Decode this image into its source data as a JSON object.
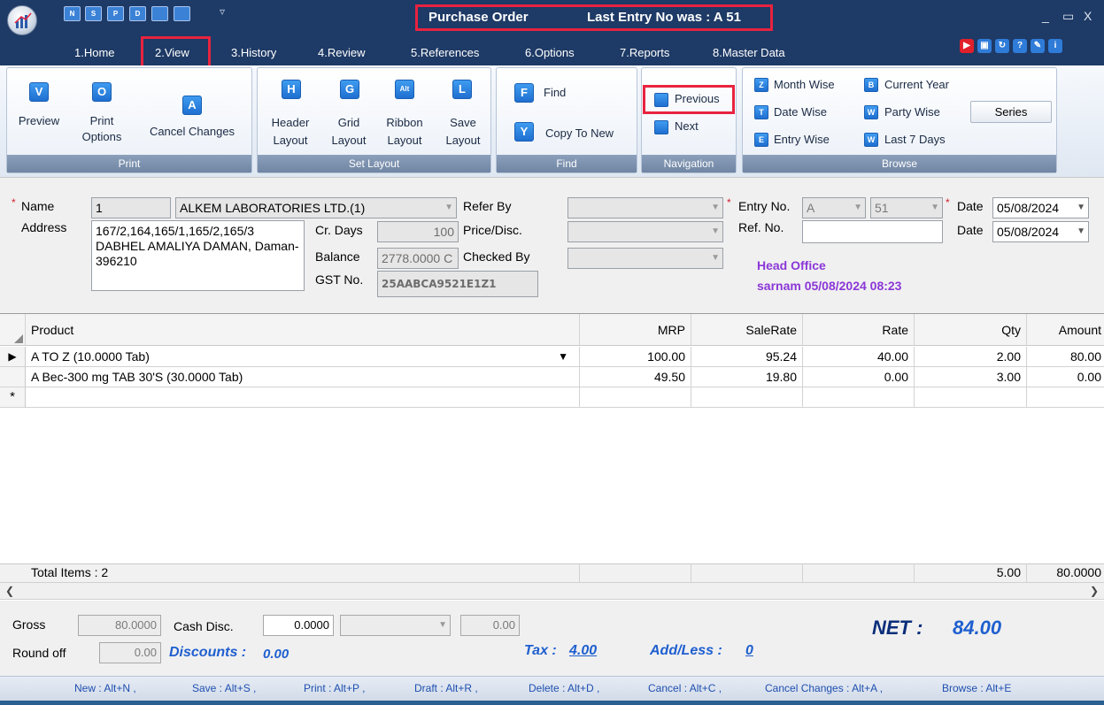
{
  "title": {
    "main": "Purchase Order",
    "last_entry": "Last Entry No was : A 51"
  },
  "quick_access": [
    "N",
    "S",
    "P",
    "D",
    "",
    ""
  ],
  "quick_access_more": "▿",
  "window_controls": [
    "_",
    "▭",
    "X"
  ],
  "menu": [
    "1.Home",
    "2.View",
    "3.History",
    "4.Review",
    "5.References",
    "6.Options",
    "7.Reports",
    "8.Master Data"
  ],
  "ribbon": {
    "print": {
      "caption": "Print",
      "preview": {
        "icon": "V",
        "label": "Preview"
      },
      "print_options": {
        "icon": "O",
        "label1": "Print",
        "label2": "Options"
      },
      "cancel_changes": {
        "icon": "A",
        "label": "Cancel Changes"
      }
    },
    "set_layout": {
      "caption": "Set Layout",
      "header": {
        "icon": "H",
        "label1": "Header",
        "label2": "Layout"
      },
      "grid": {
        "icon": "G",
        "label1": "Grid",
        "label2": "Layout"
      },
      "ribbon": {
        "icon": "Alt",
        "label1": "Ribbon",
        "label2": "Layout"
      },
      "save": {
        "icon": "L",
        "label1": "Save",
        "label2": "Layout"
      }
    },
    "find": {
      "caption": "Find",
      "find": {
        "icon": "F",
        "label": "Find"
      },
      "copy": {
        "icon": "Y",
        "label": "Copy To New"
      }
    },
    "navigation": {
      "caption": "Navigation",
      "previous": {
        "icon": "",
        "label": "Previous"
      },
      "next": {
        "icon": "",
        "label": "Next"
      }
    },
    "browse": {
      "caption": "Browse",
      "month_wise": {
        "icon": "Z",
        "label": "Month Wise"
      },
      "date_wise": {
        "icon": "T",
        "label": "Date Wise"
      },
      "entry_wise": {
        "icon": "E",
        "label": "Entry Wise"
      },
      "current_year": {
        "icon": "B",
        "label": "Current Year"
      },
      "party_wise": {
        "icon": "W",
        "label": "Party Wise"
      },
      "last_7_days": {
        "icon": "W",
        "label": "Last 7 Days"
      },
      "series": "Series"
    }
  },
  "form": {
    "required_mark": "*",
    "name_label": "Name",
    "name_code": "1",
    "name_value": "ALKEM LABORATORIES LTD.(1)",
    "address_label": "Address",
    "address_value": "167/2,164,165/1,165/2,165/3 DABHEL AMALIYA DAMAN, Daman- 396210",
    "cr_days_label": "Cr. Days",
    "cr_days_value": "100",
    "balance_label": "Balance",
    "balance_value": "2778.0000 C",
    "gst_label": "GST No.",
    "gst_value": "25AABCA9521E1Z1",
    "refer_by_label": "Refer By",
    "price_disc_label": "Price/Disc.",
    "checked_by_label": "Checked By",
    "entry_no_label": "Entry No.",
    "entry_series": "A",
    "entry_number": "51",
    "ref_no_label": "Ref. No.",
    "ref_no_value": "",
    "date_label": "Date",
    "date_value": "05/08/2024",
    "date2_label": "Date",
    "date2_value": "05/08/2024",
    "branch": "Head Office",
    "user_line": "sarnam 05/08/2024 08:23"
  },
  "grid": {
    "columns": [
      "Product",
      "MRP",
      "SaleRate",
      "Rate",
      "Qty",
      "Amount"
    ],
    "rows": [
      {
        "product": "A TO Z (10.0000  Tab)",
        "mrp": "100.00",
        "sale_rate": "95.24",
        "rate": "40.00",
        "qty": "2.00",
        "amount": "80.00"
      },
      {
        "product": "A Bec-300 mg TAB 30'S (30.0000  Tab)",
        "mrp": "49.50",
        "sale_rate": "19.80",
        "rate": "0.00",
        "qty": "3.00",
        "amount": "0.00"
      }
    ],
    "new_row_marker": "*",
    "current_row_marker": "▶",
    "total_label": "Total Items : 2",
    "total_qty": "5.00",
    "total_amount": "80.0000"
  },
  "footer": {
    "gross_label": "Gross",
    "gross_value": "80.0000",
    "cash_disc_label": "Cash Disc.",
    "cash_disc_value": "0.0000",
    "cash_disc_amount": "0.00",
    "round_off_label": "Round off",
    "round_off_value": "0.00",
    "discounts_label": "Discounts :",
    "discounts_value": "0.00",
    "tax_label": "Tax :",
    "tax_value": "4.00",
    "add_less_label": "Add/Less :",
    "add_less_value": "0",
    "net_label": "NET :",
    "net_value": "84.00"
  },
  "shortcuts": [
    "New : Alt+N ,",
    "Save : Alt+S ,",
    "Print : Alt+P ,",
    "Draft : Alt+R ,",
    "Delete : Alt+D ,",
    "Cancel : Alt+C ,",
    "Cancel Changes : Alt+A ,",
    "Browse : Alt+E"
  ],
  "colors": {
    "title_bg": "#1e3a66",
    "highlight": "#e8233f",
    "accent_blue": "#1f5fcf",
    "branch_purple": "#8b37d8"
  }
}
